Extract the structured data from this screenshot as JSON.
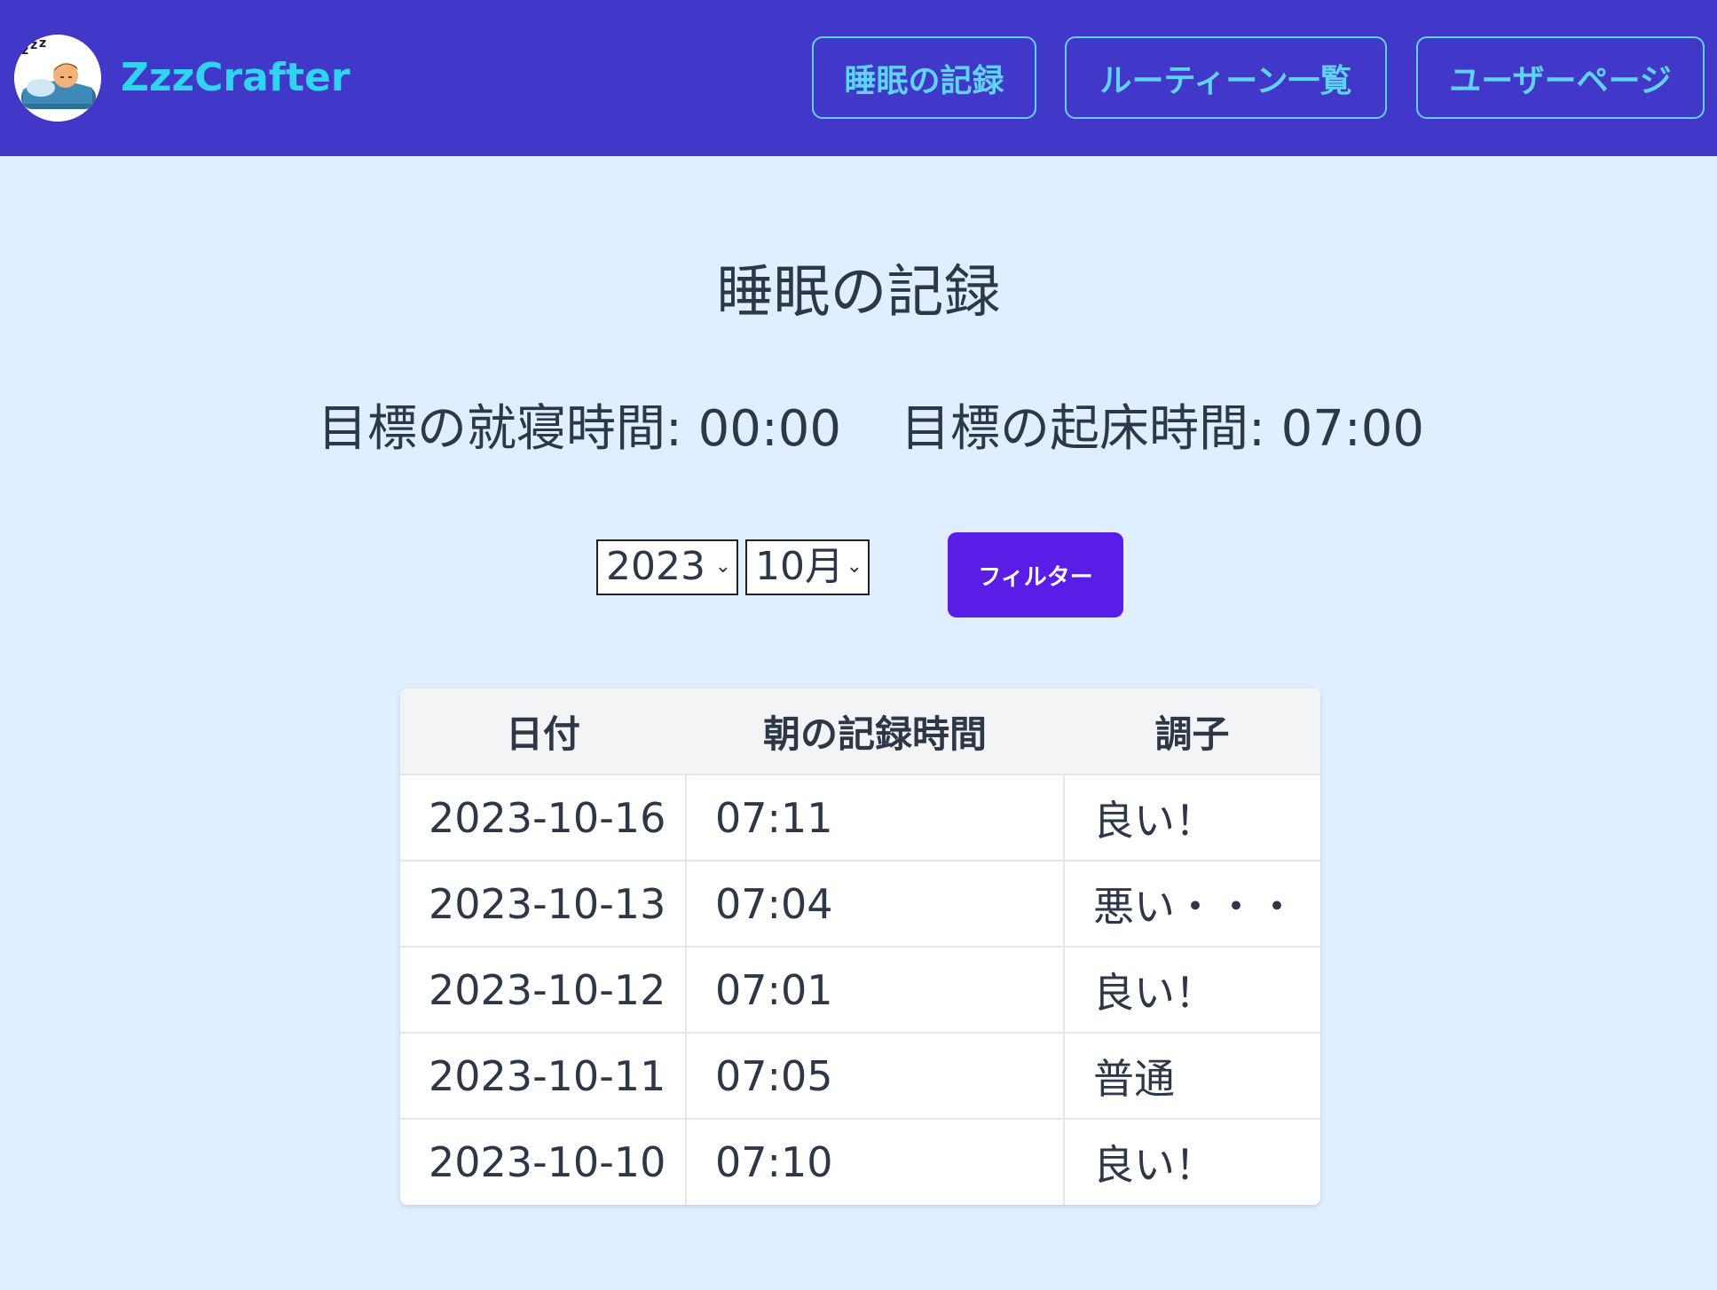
{
  "header": {
    "brand": "ZzzCrafter",
    "nav": [
      {
        "label": "睡眠の記録"
      },
      {
        "label": "ルーティーン一覧"
      },
      {
        "label": "ユーザーページ"
      }
    ],
    "colors": {
      "background": "#4137c8",
      "accent": "#5fd3f3",
      "brand": "#2fd4f0"
    }
  },
  "main": {
    "title": "睡眠の記録",
    "goal_bedtime": "目標の就寝時間: 00:00",
    "goal_waketime": "目標の起床時間: 07:00",
    "filter": {
      "year": "2023",
      "month": "10月",
      "button_label": "フィルター",
      "button_color": "#5a1de8"
    },
    "table": {
      "headers": [
        "日付",
        "朝の記録時間",
        "調子"
      ],
      "rows": [
        [
          "2023-10-16",
          "07:11",
          "良い！"
        ],
        [
          "2023-10-13",
          "07:04",
          "悪い・・・"
        ],
        [
          "2023-10-12",
          "07:01",
          "良い！"
        ],
        [
          "2023-10-11",
          "07:05",
          "普通"
        ],
        [
          "2023-10-10",
          "07:10",
          "良い！"
        ]
      ]
    }
  },
  "page_background": "#dfefff"
}
